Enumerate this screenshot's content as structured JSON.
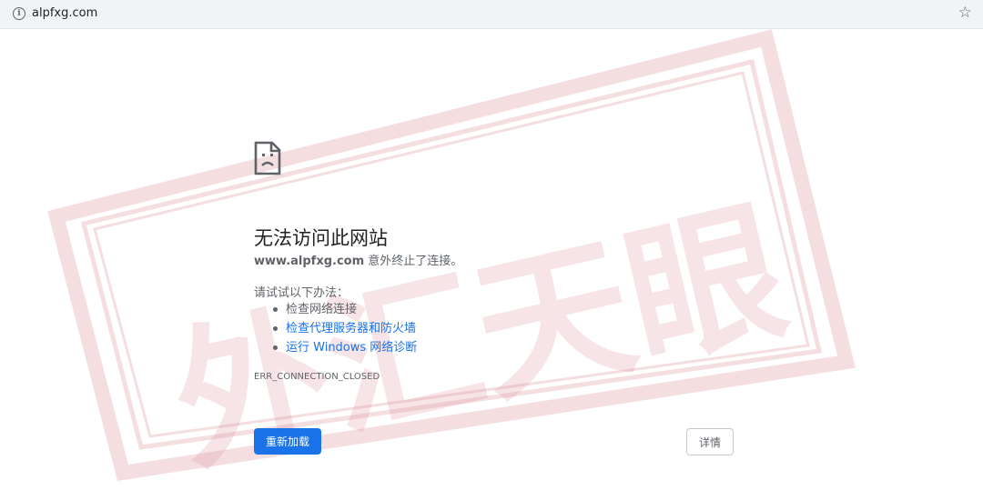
{
  "browser": {
    "url": "alpfxg.com",
    "info_icon": "info-icon",
    "bookmark_icon": "star-icon"
  },
  "watermark": {
    "text": "外汇天眼",
    "color": "#d98a93"
  },
  "error": {
    "icon": "sad-page-icon",
    "title": "无法访问此网站",
    "host": "www.alpfxg.com",
    "message": " 意外终止了连接。",
    "try_label": "请试试以下办法：",
    "suggestions": [
      "检查网络连接",
      "检查代理服务器和防火墙",
      "运行 Windows 网络诊断"
    ],
    "code": "ERR_CONNECTION_CLOSED",
    "reload_label": "重新加载",
    "details_label": "详情"
  },
  "colors": {
    "accent": "#1a73e8",
    "text": "#5f6368"
  }
}
